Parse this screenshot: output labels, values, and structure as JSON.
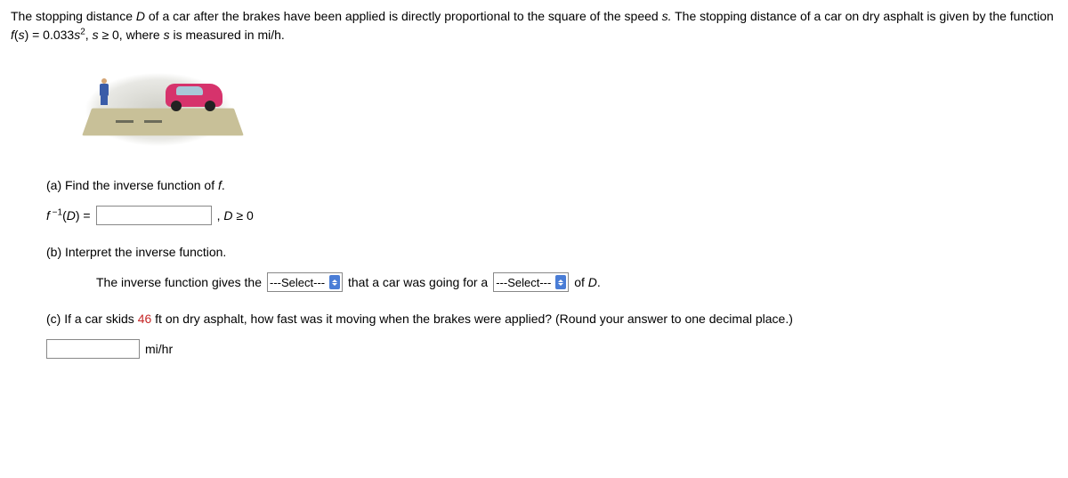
{
  "intro": {
    "text1": "The stopping distance ",
    "varD": "D",
    "text2": " of a car after the brakes have been applied is directly proportional to the square of the speed ",
    "varS": "s.",
    "text3": " The stopping distance of a car on dry asphalt is given by the function  ",
    "formula_f": "f",
    "formula_text": "(",
    "formula_s": "s",
    "formula_text2": ") = 0.033",
    "formula_s2": "s",
    "formula_sq": "2",
    "text4": ", ",
    "formula_s3": "s",
    "text5": " ≥ 0,  where ",
    "formula_s4": "s",
    "text6": " is measured in mi/h."
  },
  "partA": {
    "label": "(a) Find the inverse function of ",
    "fvar": "f",
    "labelDot": ".",
    "lhs_f": "f",
    "lhs_exp": " −1",
    "lhs_open": "(",
    "lhs_D": "D",
    "lhs_close": ") =",
    "after_input": " , ",
    "cond_D": "D",
    "cond_text": " ≥ 0"
  },
  "partB": {
    "label": "(b) Interpret the inverse function.",
    "line_start": "The inverse function gives the",
    "select1_default": "---Select---",
    "mid": " that a car was going for a ",
    "select2_default": "---Select---",
    "tail": " of ",
    "tail_D": "D",
    "tail_dot": "."
  },
  "partC": {
    "text1": "(c) If a car skids ",
    "skid_value": "46",
    "text2": " ft on dry asphalt, how fast was it moving when the brakes were applied? (Round your answer to one decimal place.)",
    "unit": " mi/hr"
  }
}
